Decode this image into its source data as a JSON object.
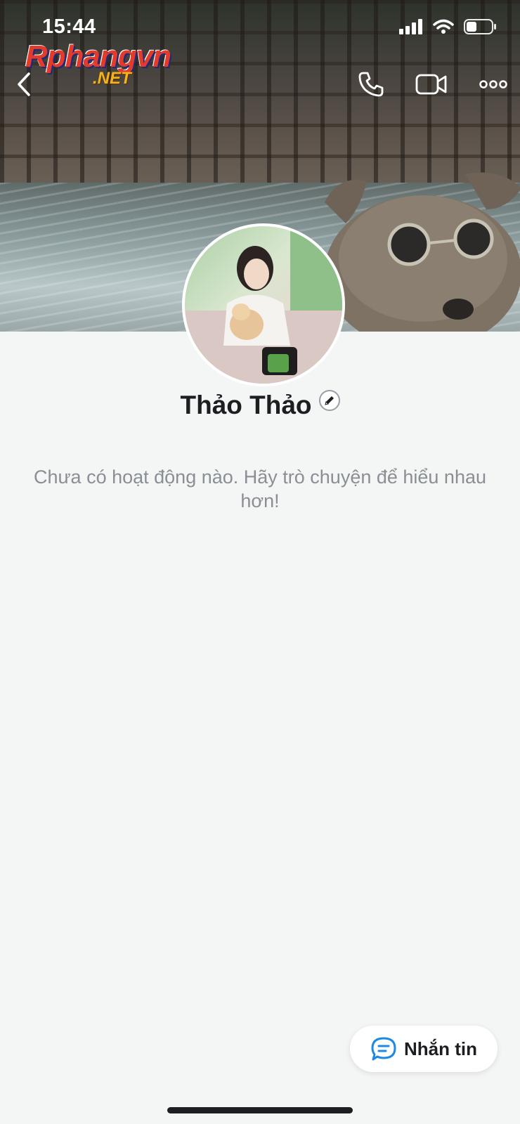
{
  "status_bar": {
    "time": "15:44"
  },
  "watermark": {
    "main": "Rphangvn",
    "sub": ".NET"
  },
  "header": {
    "back_icon": "chevron-left-icon",
    "call_icon": "phone-icon",
    "video_icon": "video-camera-icon",
    "more_icon": "more-dots-icon"
  },
  "profile": {
    "name": "Thảo Thảo",
    "edit_icon": "pencil-icon"
  },
  "feed": {
    "empty_message": "Chưa có hoạt động nào. Hãy trò chuyện để hiểu nhau hơn!"
  },
  "actions": {
    "message_label": "Nhắn tin",
    "message_icon": "chat-bubble-icon"
  },
  "colors": {
    "accent": "#1e88e5",
    "background": "#f4f5f5",
    "text_primary": "#1c1e21",
    "text_secondary": "#8a8f95"
  }
}
